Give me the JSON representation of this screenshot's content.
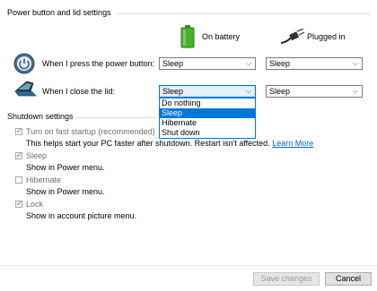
{
  "power_section": {
    "title": "Power button and lid settings"
  },
  "columns": {
    "battery": "On battery",
    "plugged": "Plugged in"
  },
  "rows": {
    "power_button": {
      "label": "When I press the power button:",
      "battery": "Sleep",
      "plugged": "Sleep"
    },
    "lid": {
      "label": "When I close the lid:",
      "battery": "Sleep",
      "plugged": "Sleep"
    }
  },
  "lid_dropdown": {
    "options": [
      "Do nothing",
      "Sleep",
      "Hibernate",
      "Shut down"
    ],
    "selected": "Sleep"
  },
  "shutdown_section": {
    "title": "Shutdown settings",
    "items": [
      {
        "label": "Turn on fast startup (recommended)",
        "checked": true,
        "description": "This helps start your PC faster after shutdown. Restart isn't affected.",
        "link": "Learn More"
      },
      {
        "label": "Sleep",
        "checked": true,
        "description": "Show in Power menu."
      },
      {
        "label": "Hibernate",
        "checked": false,
        "description": "Show in Power menu."
      },
      {
        "label": "Lock",
        "checked": true,
        "description": "Show in account picture menu."
      }
    ]
  },
  "buttons": {
    "save": "Save changes",
    "cancel": "Cancel"
  },
  "icons": {
    "battery": "battery-icon",
    "plug": "plug-icon",
    "power_button": "power-button-icon",
    "laptop_lid": "laptop-lid-icon",
    "chevron": "chevron-down-icon"
  },
  "colors": {
    "accent": "#0078d7",
    "link": "#0066cc",
    "battery_green": "#4cae2e"
  }
}
